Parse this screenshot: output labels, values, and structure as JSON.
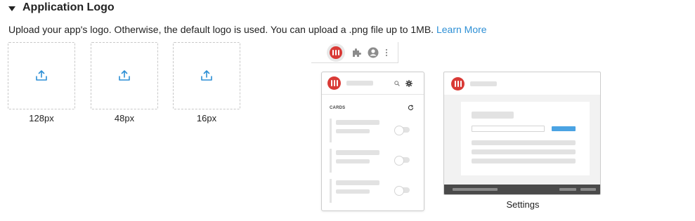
{
  "section": {
    "title": "Application Logo",
    "description": "Upload your app's logo. Otherwise, the default logo is used. You can upload a .png file up to 1MB.",
    "learn_more": "Learn More"
  },
  "uploads": [
    {
      "label": "128px",
      "icon": "upload-icon"
    },
    {
      "label": "48px",
      "icon": "upload-icon"
    },
    {
      "label": "16px",
      "icon": "upload-icon"
    }
  ],
  "preview": {
    "popup": {
      "cards_label": "CARDS",
      "icons": [
        "search-icon",
        "gear-icon",
        "refresh-icon"
      ]
    },
    "settings": {
      "label": "Settings"
    },
    "browser_bar": {
      "icons": [
        "extension-logo-icon",
        "puzzle-icon",
        "profile-icon",
        "more-vertical-icon"
      ]
    }
  },
  "colors": {
    "brand_red": "#d93a36",
    "link": "#2d8fd5",
    "upload_icon": "#2d8fd5",
    "settings_button": "#4ba3e3"
  }
}
